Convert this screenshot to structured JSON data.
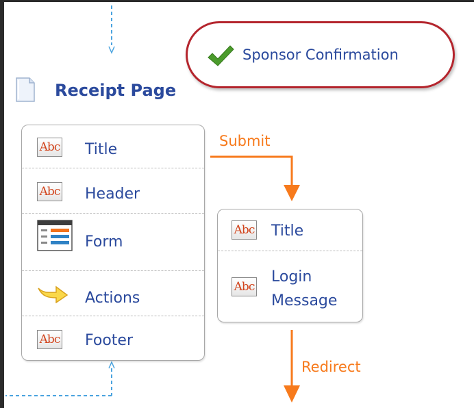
{
  "page": {
    "title": "Receipt Page",
    "icon": "page-icon"
  },
  "confirmation": {
    "label": "Sponsor Confirmation",
    "icon": "checkmark-icon",
    "highlight_color": "#b4252d"
  },
  "receipt_components": [
    {
      "label": "Title",
      "icon": "text-abc-icon"
    },
    {
      "label": "Header",
      "icon": "text-abc-icon"
    },
    {
      "label": "Form",
      "icon": "form-icon"
    },
    {
      "label": "Actions",
      "icon": "arrow-icon"
    },
    {
      "label": "Footer",
      "icon": "text-abc-icon"
    }
  ],
  "confirmation_components": [
    {
      "label": "Title",
      "icon": "text-abc-icon"
    },
    {
      "label_lines": [
        "Login",
        "Message"
      ],
      "icon": "text-abc-icon"
    }
  ],
  "edges": {
    "submit": "Submit",
    "redirect": "Redirect"
  },
  "icon_text": "Abc",
  "colors": {
    "title": "#2b4a9d",
    "edge": "#f77a1c",
    "dashed_connector": "#4aa3df"
  }
}
